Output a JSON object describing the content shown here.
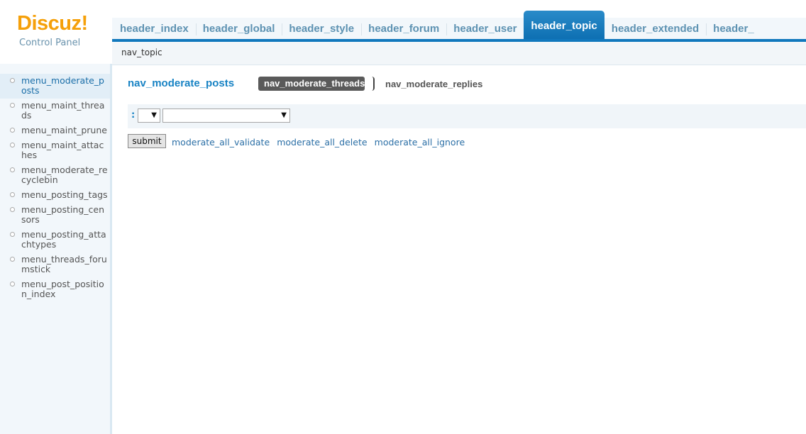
{
  "logo": {
    "mark": "Discuz!",
    "subtitle": "Control Panel"
  },
  "header_tabs": [
    {
      "label": "header_index",
      "active": false
    },
    {
      "label": "header_global",
      "active": false
    },
    {
      "label": "header_style",
      "active": false
    },
    {
      "label": "header_forum",
      "active": false
    },
    {
      "label": "header_user",
      "active": false
    },
    {
      "label": "header_topic",
      "active": true
    },
    {
      "label": "header_extended",
      "active": false
    },
    {
      "label": "header_",
      "active": false
    }
  ],
  "subnav": {
    "text": "nav_topic"
  },
  "sidebar": {
    "items": [
      {
        "label": "menu_moderate_posts",
        "active": true
      },
      {
        "label": "menu_maint_threads",
        "active": false
      },
      {
        "label": "menu_maint_prune",
        "active": false
      },
      {
        "label": "menu_maint_attaches",
        "active": false
      },
      {
        "label": "menu_moderate_recyclebin",
        "active": false
      },
      {
        "label": "menu_posting_tags",
        "active": false
      },
      {
        "label": "menu_posting_censors",
        "active": false
      },
      {
        "label": "menu_posting_attachtypes",
        "active": false
      },
      {
        "label": "menu_threads_forumstick",
        "active": false
      },
      {
        "label": "menu_post_position_index",
        "active": false
      }
    ]
  },
  "main": {
    "title": "nav_moderate_posts",
    "tabs": [
      {
        "label": "nav_moderate_threads",
        "active": true
      },
      {
        "label": "nav_moderate_replies",
        "active": false
      }
    ],
    "filter": {
      "prefix": ":",
      "select1_value": "",
      "select2_value": ""
    },
    "submit_label": "submit",
    "actions": [
      "moderate_all_validate",
      "moderate_all_delete",
      "moderate_all_ignore"
    ]
  },
  "colors": {
    "accent": "#1883c4",
    "active_tab": "#0d6fb2",
    "logo": "#f5a00a",
    "sidebar_bg": "#f2f7fb"
  }
}
